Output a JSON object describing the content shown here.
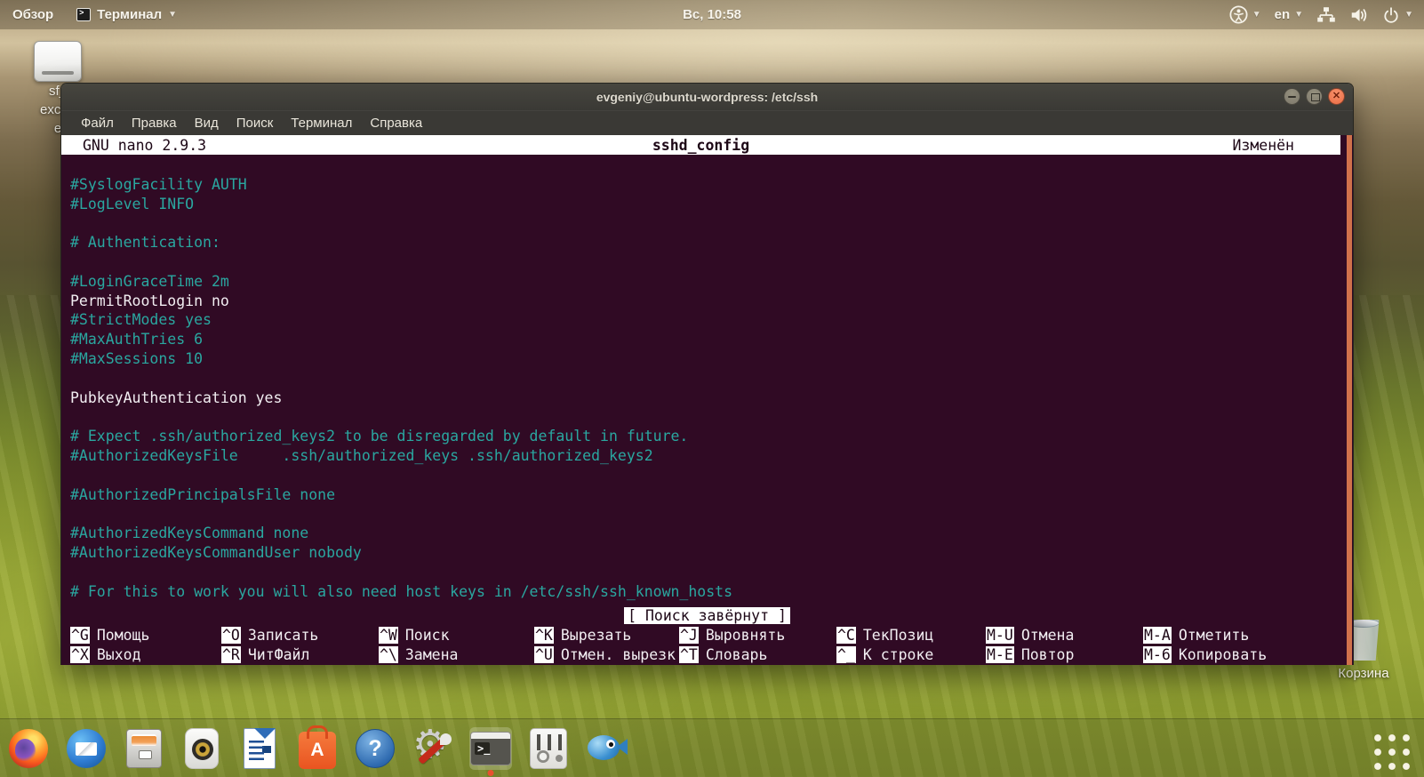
{
  "top_bar": {
    "activities_label": "Обзор",
    "focused_app": "Терминал",
    "clock": "Вс, 10:58",
    "language": "en"
  },
  "desktop": {
    "drive_label_line1": "sf_",
    "drive_label_line2": "excha",
    "drive_label_line3": "e",
    "trash_label": "Корзина"
  },
  "terminal_window": {
    "title": "evgeniy@ubuntu-wordpress: /etc/ssh",
    "menu": [
      "Файл",
      "Правка",
      "Вид",
      "Поиск",
      "Терминал",
      "Справка"
    ]
  },
  "nano": {
    "app_version": "GNU nano 2.9.3",
    "filename": "sshd_config",
    "modified_flag": "Изменён",
    "status_message": "[ Поиск завёрнут ]",
    "lines": [
      {
        "t": "",
        "k": "blank"
      },
      {
        "t": "#SyslogFacility AUTH",
        "k": "comment"
      },
      {
        "t": "#LogLevel INFO",
        "k": "comment"
      },
      {
        "t": "",
        "k": "blank"
      },
      {
        "t": "# Authentication:",
        "k": "comment"
      },
      {
        "t": "",
        "k": "blank"
      },
      {
        "t": "#LoginGraceTime 2m",
        "k": "comment"
      },
      {
        "t": "PermitRootLogin no",
        "k": "plain"
      },
      {
        "t": "#StrictModes yes",
        "k": "comment"
      },
      {
        "t": "#MaxAuthTries 6",
        "k": "comment"
      },
      {
        "t": "#MaxSessions 10",
        "k": "comment"
      },
      {
        "t": "",
        "k": "blank"
      },
      {
        "t": "PubkeyAuthentication yes",
        "k": "plain"
      },
      {
        "t": "",
        "k": "blank"
      },
      {
        "t": "# Expect .ssh/authorized_keys2 to be disregarded by default in future.",
        "k": "comment"
      },
      {
        "t": "#AuthorizedKeysFile     .ssh/authorized_keys .ssh/authorized_keys2",
        "k": "comment"
      },
      {
        "t": "",
        "k": "blank"
      },
      {
        "t": "#AuthorizedPrincipalsFile none",
        "k": "comment"
      },
      {
        "t": "",
        "k": "blank"
      },
      {
        "t": "#AuthorizedKeysCommand none",
        "k": "comment"
      },
      {
        "t": "#AuthorizedKeysCommandUser nobody",
        "k": "comment"
      },
      {
        "t": "",
        "k": "blank"
      },
      {
        "t": "# For this to work you will also need host keys in /etc/ssh/ssh_known_hosts",
        "k": "comment"
      }
    ],
    "shortcuts_row1": [
      {
        "key": "^G",
        "label": "Помощь"
      },
      {
        "key": "^O",
        "label": "Записать"
      },
      {
        "key": "^W",
        "label": "Поиск"
      },
      {
        "key": "^K",
        "label": "Вырезать"
      },
      {
        "key": "^J",
        "label": "Выровнять"
      },
      {
        "key": "^C",
        "label": "ТекПозиц"
      },
      {
        "key": "M-U",
        "label": "Отмена"
      },
      {
        "key": "M-A",
        "label": "Отметить"
      }
    ],
    "shortcuts_row2": [
      {
        "key": "^X",
        "label": "Выход"
      },
      {
        "key": "^R",
        "label": "ЧитФайл"
      },
      {
        "key": "^\\",
        "label": "Замена"
      },
      {
        "key": "^U",
        "label": "Отмен. вырезк"
      },
      {
        "key": "^T",
        "label": "Словарь"
      },
      {
        "key": "^_",
        "label": "К строке"
      },
      {
        "key": "M-E",
        "label": "Повтор"
      },
      {
        "key": "M-6",
        "label": "Копировать"
      }
    ]
  },
  "dock": {
    "items": [
      "firefox",
      "thunderbird",
      "files",
      "rhythmbox",
      "writer",
      "software",
      "help",
      "settings",
      "terminal",
      "tweaks",
      "bluefish"
    ],
    "active_item": "terminal",
    "software_glyph": "A",
    "help_glyph": "?",
    "terminal_glyph": ">_",
    "gear_glyph": "⚙"
  },
  "colors": {
    "terminal_background": "#300a24",
    "comment_text": "#2aa7a0",
    "plain_text": "#f2eef2",
    "nano_bar_background": "#ffffff",
    "nano_bar_text": "#1d0716",
    "scrollbar": "#d0714b",
    "close_button": "#ef7550"
  }
}
